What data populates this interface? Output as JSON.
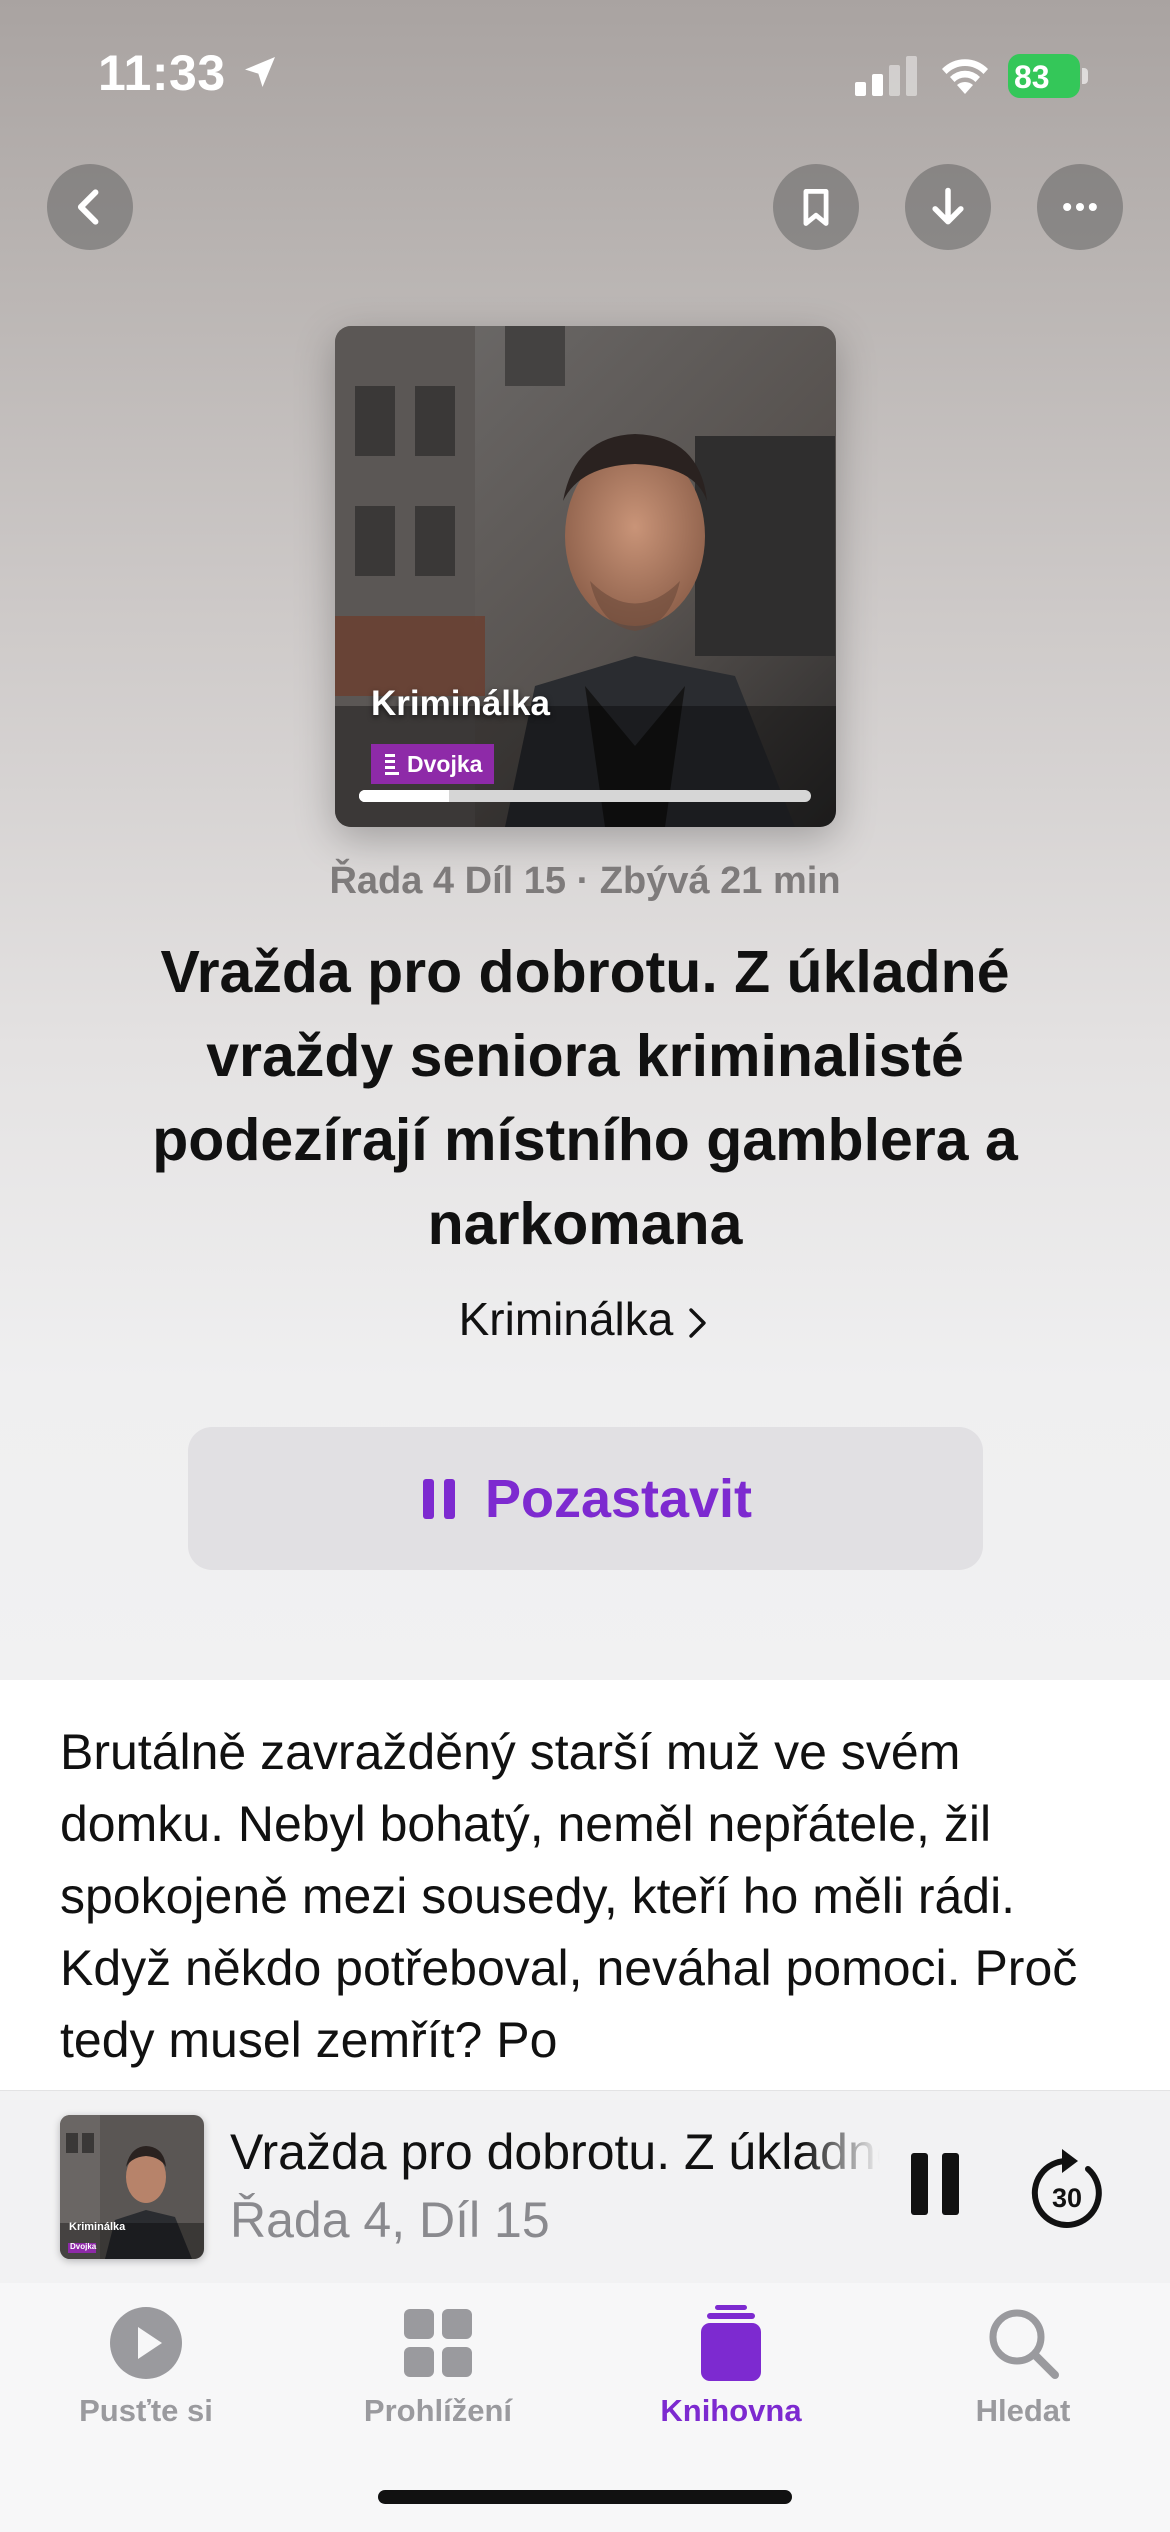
{
  "status_bar": {
    "time": "11:33",
    "battery": "83",
    "icons": [
      "location-arrow-icon",
      "cellular-signal-icon",
      "wifi-icon",
      "battery-icon"
    ]
  },
  "toolbar": {
    "icons": [
      "chevron-left-icon",
      "bookmark-icon",
      "download-icon",
      "more-icon"
    ]
  },
  "artwork": {
    "show_name": "Kriminálka",
    "badge": "Dvojka",
    "badge_color": "#8e2aa8",
    "progress": 0.2
  },
  "episode": {
    "meta": "Řada 4 Díl 15 · Zbývá 21 min",
    "title": "Vražda pro dobrotu. Z úkladné vraždy seniora kriminalisté podezírají místního gamblera a narkomana",
    "show_link": "Kriminálka",
    "action_label": "Pozastavit",
    "description": "Brutálně zavražděný starší muž ve svém domku. Nebyl bohatý, neměl nepřátele, žil spokojeně mezi sousedy, kteří ho měli rádi. Když někdo potřeboval, neváhal pomoci. Proč tedy musel zemřít? Po"
  },
  "mini_player": {
    "title": "Vražda pro dobrotu. Z úkladné vraždy seniora",
    "subtitle": "Řada 4, Díl 15",
    "artwork_show_name": "Kriminálka",
    "artwork_badge": "Dvojka",
    "skip_seconds": "30"
  },
  "tabs": [
    {
      "label": "Pusťte si",
      "icon": "play-circle-icon",
      "active": false
    },
    {
      "label": "Prohlížení",
      "icon": "grid-icon",
      "active": false
    },
    {
      "label": "Knihovna",
      "icon": "library-stack-icon",
      "active": true
    },
    {
      "label": "Hledat",
      "icon": "search-icon",
      "active": false
    }
  ],
  "colors": {
    "accent": "#7d2ad0",
    "battery": "#34c759",
    "inactive_tab": "#9a9a9e"
  }
}
